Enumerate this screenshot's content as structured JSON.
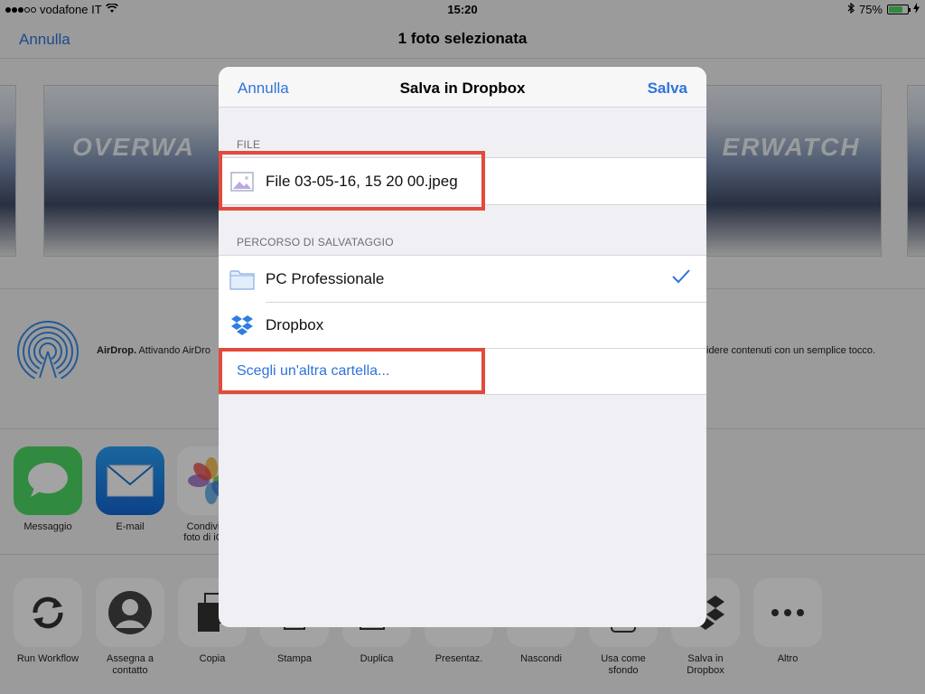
{
  "status_bar": {
    "carrier": "vodafone IT",
    "time": "15:20",
    "battery": "75%",
    "battery_level": 0.75
  },
  "share_sheet": {
    "cancel_label": "Annulla",
    "title": "1 foto selezionata",
    "thumbnail_text": [
      "OVERWA",
      "ERWATCH"
    ],
    "airdrop": {
      "label_bold": "AirDrop.",
      "text_start": " Attivando AirDro",
      "text_end": "idere contenuti con un semplice tocco."
    },
    "apps": [
      {
        "label_line1": "Messaggio",
        "label_line2": "",
        "icon": "messages-icon",
        "color": "#4cd964"
      },
      {
        "label_line1": "E-mail",
        "label_line2": "",
        "icon": "mail-icon",
        "color": "#1e88f0"
      },
      {
        "label_line1": "Condivi",
        "label_line2": "foto di iC",
        "icon": "photos-icon",
        "color": "#ffffff"
      }
    ],
    "actions": [
      {
        "label_line1": "Run Workflow",
        "label_line2": "",
        "icon": "workflow-icon"
      },
      {
        "label_line1": "Assegna a",
        "label_line2": "contatto",
        "icon": "contact-icon"
      },
      {
        "label_line1": "Copia",
        "label_line2": "",
        "icon": "copy-icon"
      },
      {
        "label_line1": "Stampa",
        "label_line2": "",
        "icon": "print-icon"
      },
      {
        "label_line1": "Duplica",
        "label_line2": "",
        "icon": "duplicate-icon"
      },
      {
        "label_line1": "Presentaz.",
        "label_line2": "",
        "icon": "slideshow-icon"
      },
      {
        "label_line1": "Nascondi",
        "label_line2": "",
        "icon": "hide-icon"
      },
      {
        "label_line1": "Usa come",
        "label_line2": "sfondo",
        "icon": "wallpaper-icon"
      },
      {
        "label_line1": "Salva in",
        "label_line2": "Dropbox",
        "icon": "dropbox-icon"
      },
      {
        "label_line1": "Altro",
        "label_line2": "",
        "icon": "more-icon"
      }
    ]
  },
  "dialog": {
    "cancel_label": "Annulla",
    "title": "Salva in Dropbox",
    "save_label": "Salva",
    "file_section_header": "FILE",
    "file_name": "File 03-05-16, 15 20 00.jpeg",
    "path_section_header": "PERCORSO DI SALVATAGGIO",
    "locations": [
      {
        "label": "PC Professionale",
        "icon": "folder-icon",
        "selected": true
      },
      {
        "label": "Dropbox",
        "icon": "dropbox-icon",
        "selected": false
      }
    ],
    "choose_other_label": "Scegli un'altra cartella..."
  },
  "colors": {
    "accent": "#2f74d8",
    "highlight": "#e24a3b",
    "checkmark": "#2f74d8"
  }
}
